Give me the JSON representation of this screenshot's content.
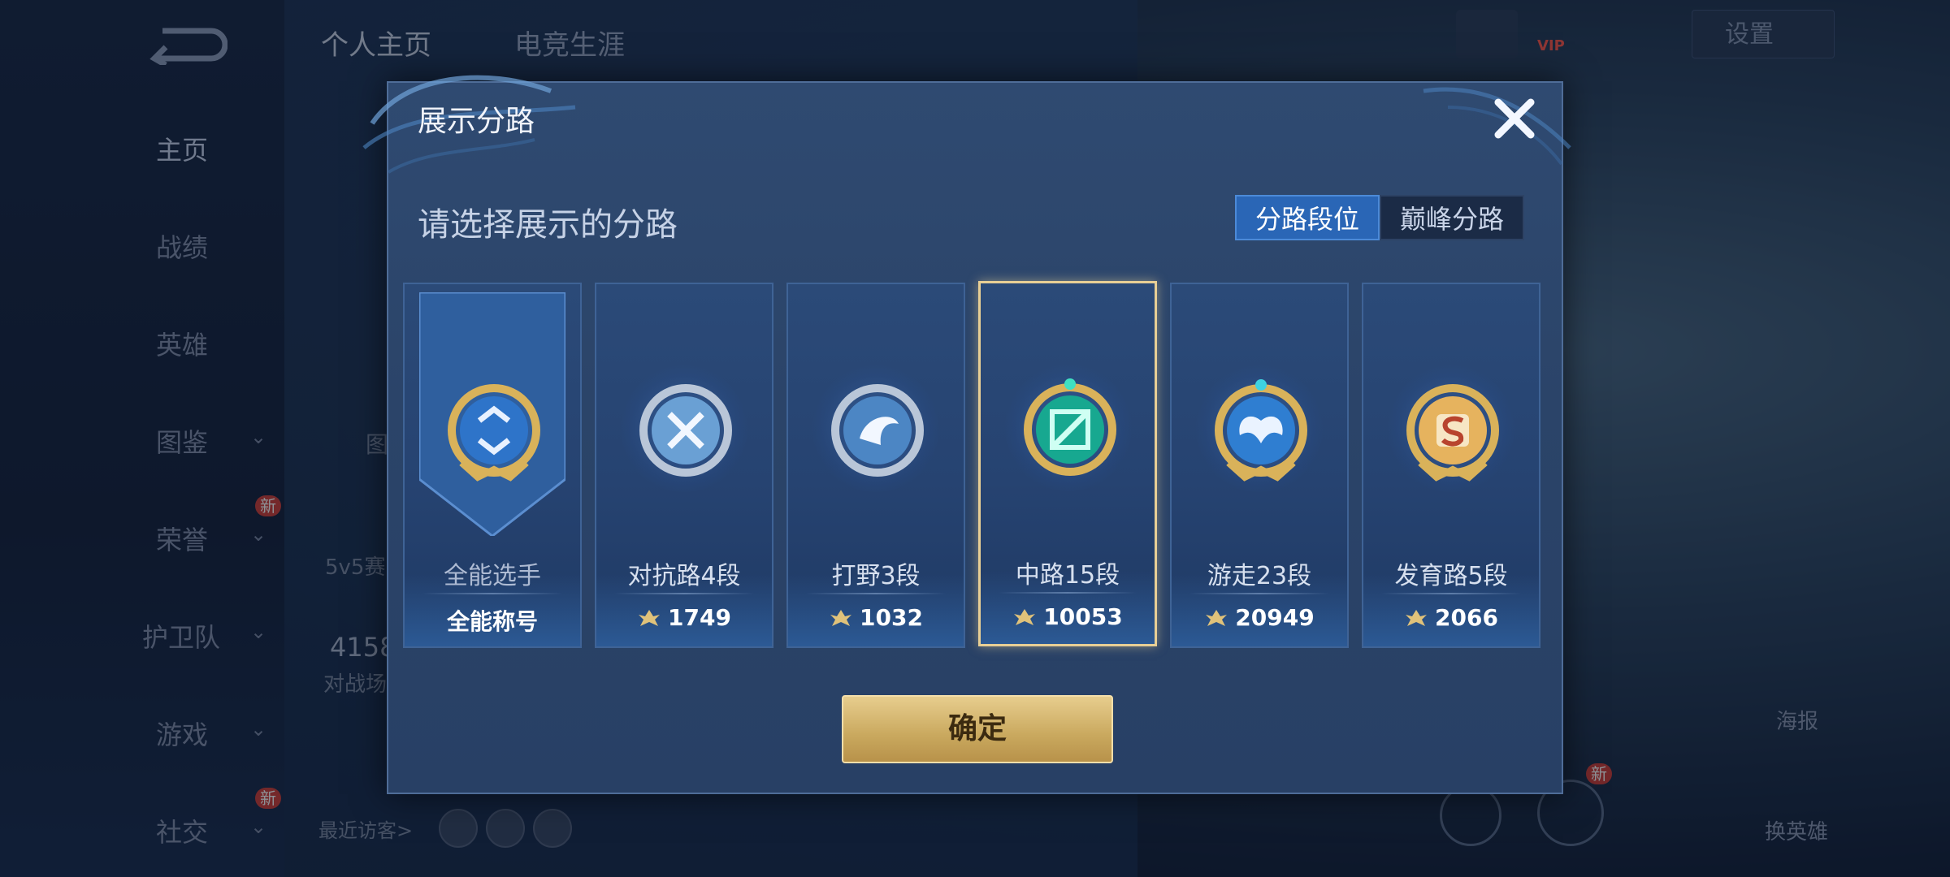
{
  "top_tabs": [
    "个人主页",
    "电竞生涯"
  ],
  "nav": [
    {
      "label": "主页",
      "active": true,
      "has_chevron": false,
      "new": false
    },
    {
      "label": "战绩",
      "active": false,
      "has_chevron": false,
      "new": false
    },
    {
      "label": "英雄",
      "active": false,
      "has_chevron": false,
      "new": false
    },
    {
      "label": "图鉴",
      "active": false,
      "has_chevron": true,
      "new": false
    },
    {
      "label": "荣誉",
      "active": false,
      "has_chevron": true,
      "new": true
    },
    {
      "label": "护卫队",
      "active": false,
      "has_chevron": true,
      "new": false
    },
    {
      "label": "游戏",
      "active": false,
      "has_chevron": true,
      "new": false
    },
    {
      "label": "社交",
      "active": false,
      "has_chevron": true,
      "new": true
    }
  ],
  "new_badge": "新",
  "partial_texts": {
    "mode": "5v5赛",
    "count": "4158",
    "battle": "对战场",
    "tu": "图"
  },
  "recent_visitors": "最近访客>",
  "vip": "VIP",
  "settings": "设置",
  "side_buttons": {
    "poster": "海报",
    "change_hero": "换英雄"
  },
  "modal": {
    "title": "展示分路",
    "subtitle": "请选择展示的分路",
    "segments": [
      "分路段位",
      "巅峰分路"
    ],
    "active_segment": 0,
    "confirm": "确定",
    "cards": [
      {
        "name": "全能选手",
        "score": "全能称号",
        "icon": "all-round-emblem-icon",
        "selected": false,
        "has_points_icon": false
      },
      {
        "name": "对抗路4段",
        "score": "1749",
        "icon": "clash-lane-emblem-icon",
        "selected": false,
        "has_points_icon": true
      },
      {
        "name": "打野3段",
        "score": "1032",
        "icon": "jungle-emblem-icon",
        "selected": false,
        "has_points_icon": true
      },
      {
        "name": "中路15段",
        "score": "10053",
        "icon": "mid-lane-emblem-icon",
        "selected": true,
        "has_points_icon": true
      },
      {
        "name": "游走23段",
        "score": "20949",
        "icon": "roam-emblem-icon",
        "selected": false,
        "has_points_icon": true
      },
      {
        "name": "发育路5段",
        "score": "2066",
        "icon": "farm-lane-emblem-icon",
        "selected": false,
        "has_points_icon": true
      }
    ]
  },
  "colors": {
    "modal_bg": "#2c466c",
    "active_segment": "#2a66b6",
    "selected_border": "#e8cf95",
    "confirm_gold": "#d4b46e",
    "badge_red": "#d0413b"
  }
}
